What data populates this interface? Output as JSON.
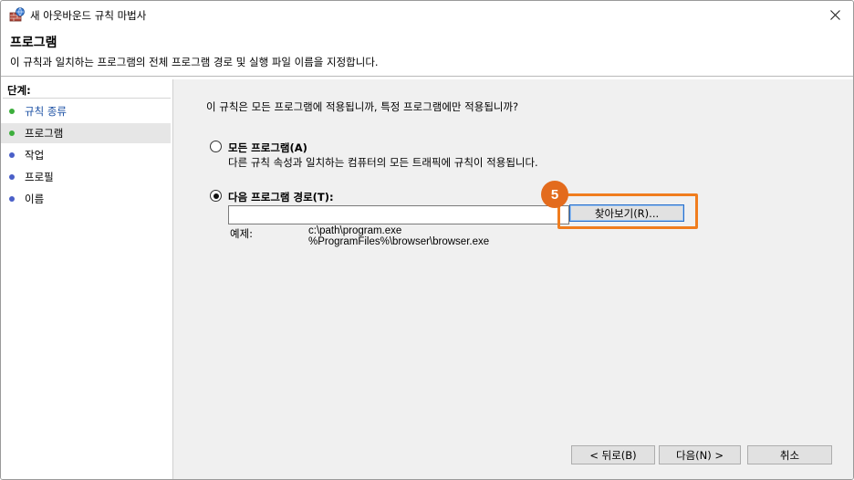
{
  "window": {
    "title": "새 아웃바운드 규칙 마법사",
    "close_glyph": "✕"
  },
  "header": {
    "title": "프로그램",
    "description": "이 규칙과 일치하는 프로그램의 전체 프로그램 경로 및 실행 파일 이름을 지정합니다."
  },
  "sidebar": {
    "steps_label": "단계:",
    "steps": [
      {
        "label": "규칙 종류",
        "state": "done",
        "dot_color": "#3cae3c"
      },
      {
        "label": "프로그램",
        "state": "current",
        "dot_color": "#3cae3c"
      },
      {
        "label": "작업",
        "state": "pending",
        "dot_color": "#4a5fc8"
      },
      {
        "label": "프로필",
        "state": "pending",
        "dot_color": "#4a5fc8"
      },
      {
        "label": "이름",
        "state": "pending",
        "dot_color": "#4a5fc8"
      }
    ]
  },
  "main": {
    "question": "이 규칙은 모든 프로그램에 적용됩니까, 특정 프로그램에만 적용됩니까?",
    "options": [
      {
        "label": "모든 프로그램(A)",
        "description": "다른 규칙 속성과 일치하는 컴퓨터의 모든 트래픽에 규칙이 적용됩니다.",
        "selected": false
      },
      {
        "label": "다음 프로그램 경로(T):",
        "selected": true
      }
    ],
    "path_value": "",
    "browse_label": "찾아보기(R)...",
    "step_badge": "5",
    "highlight_color": "#f07d1e",
    "example_label": "예제:",
    "example_lines": [
      "c:\\path\\program.exe",
      "%ProgramFiles%\\browser\\browser.exe"
    ]
  },
  "footer": {
    "back_label": "< 뒤로(B)",
    "next_label": "다음(N) >",
    "cancel_label": "취소"
  }
}
